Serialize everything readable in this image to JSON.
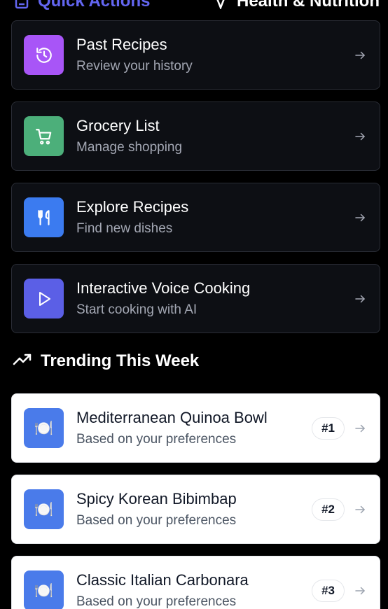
{
  "header": {
    "quick_actions_title": "Quick Actions",
    "health_title": "Health & Nutrition"
  },
  "quick_actions": [
    {
      "title": "Past Recipes",
      "subtitle": "Review your history",
      "icon": "history-icon",
      "color": "#a855f7"
    },
    {
      "title": "Grocery List",
      "subtitle": "Manage shopping",
      "icon": "cart-icon",
      "color": "#4caf7a"
    },
    {
      "title": "Explore Recipes",
      "subtitle": "Find new dishes",
      "icon": "utensils-icon",
      "color": "#3b7bf0"
    },
    {
      "title": "Interactive Voice Cooking",
      "subtitle": "Start cooking with AI",
      "icon": "play-icon",
      "color": "#5b5fe6"
    }
  ],
  "trending": {
    "title": "Trending This Week",
    "items": [
      {
        "title": "Mediterranean Quinoa Bowl",
        "subtitle": "Based on your preferences",
        "rank": "#1",
        "icon": "plate-icon"
      },
      {
        "title": "Spicy Korean Bibimbap",
        "subtitle": "Based on your preferences",
        "rank": "#2",
        "icon": "plate-icon"
      },
      {
        "title": "Classic Italian Carbonara",
        "subtitle": "Based on your preferences",
        "rank": "#3",
        "icon": "plate-icon"
      }
    ]
  },
  "colors": {
    "accent": "#6366f1",
    "card_dark": "#0d0f14",
    "trend_icon_bg": "#4a7bea"
  }
}
